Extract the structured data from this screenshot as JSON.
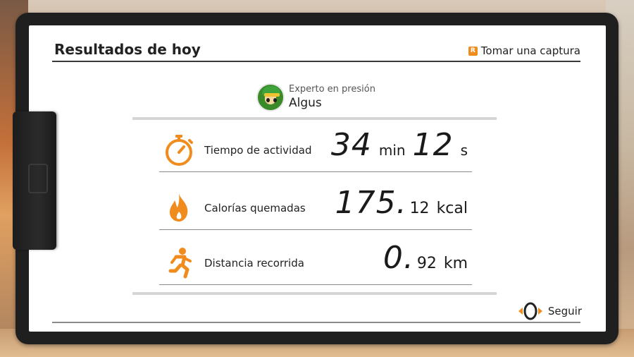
{
  "header": {
    "title": "Resultados de hoy",
    "capture_badge": "R",
    "capture_label": "Tomar una captura"
  },
  "user": {
    "title": "Experto en presión",
    "name": "Algus",
    "avatar_icon": "link-avatar-icon"
  },
  "stats": [
    {
      "icon": "stopwatch-icon",
      "label": "Tiempo de actividad",
      "minutes": "34",
      "minutes_unit": "min",
      "seconds": "12",
      "seconds_unit": "s"
    },
    {
      "icon": "flame-icon",
      "label": "Calorías quemadas",
      "integer": "175.",
      "decimal": "12",
      "unit": "kcal"
    },
    {
      "icon": "runner-icon",
      "label": "Distancia recorrida",
      "integer": "0.",
      "decimal": "92",
      "unit": "km"
    }
  ],
  "footer": {
    "continue_label": "Seguir",
    "continue_icon": "ring-con-icon"
  },
  "colors": {
    "accent": "#f08c1e",
    "frame": "#1f1f1f",
    "paper": "#ffffff"
  }
}
